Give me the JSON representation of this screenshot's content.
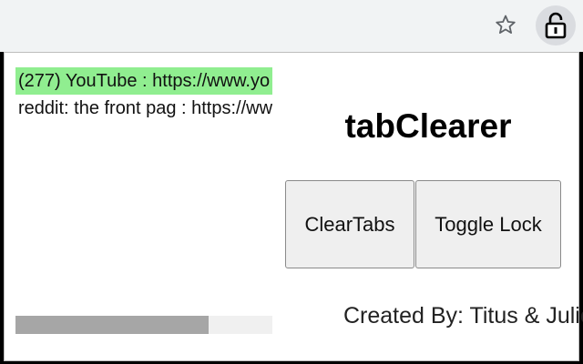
{
  "browser": {
    "star_icon": "star-icon",
    "extension_icon": "lock-open-icon"
  },
  "popup": {
    "tabs": [
      {
        "label": "(277) YouTube : https://www.yo",
        "active": true
      },
      {
        "label": "reddit: the front pag : https://ww",
        "active": false
      }
    ],
    "scroll_position": 0.75,
    "title": "tabClearer",
    "clear_button": "ClearTabs",
    "lock_button": "Toggle Lock",
    "credits": "Created By: Titus & Julio"
  },
  "colors": {
    "active_tab": "#90ee90",
    "button_bg": "#efefef",
    "toolbar_bg": "#f1f3f4"
  }
}
